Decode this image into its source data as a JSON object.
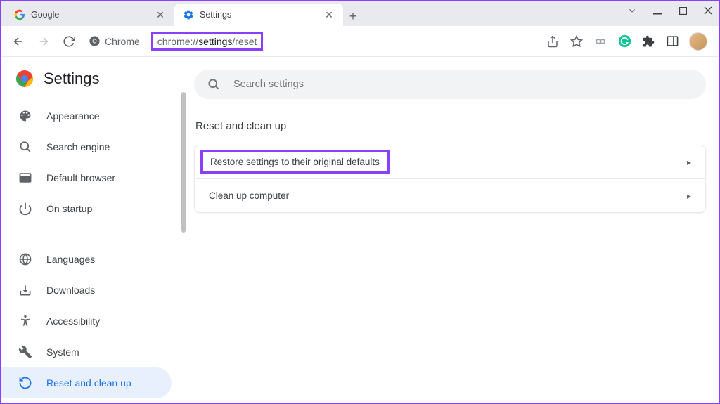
{
  "tabs": [
    {
      "title": "Google",
      "icon": "google"
    },
    {
      "title": "Settings",
      "icon": "gear-blue"
    }
  ],
  "url": {
    "prefix": "chrome://",
    "dark": "settings",
    "suffix": "/reset"
  },
  "chrome_label": "Chrome",
  "settings_title": "Settings",
  "search_placeholder": "Search settings",
  "sidebar": {
    "items": [
      {
        "icon": "palette",
        "label": "Appearance"
      },
      {
        "icon": "search",
        "label": "Search engine"
      },
      {
        "icon": "browser",
        "label": "Default browser"
      },
      {
        "icon": "power",
        "label": "On startup"
      }
    ],
    "items2": [
      {
        "icon": "globe",
        "label": "Languages"
      },
      {
        "icon": "download",
        "label": "Downloads"
      },
      {
        "icon": "accessibility",
        "label": "Accessibility"
      },
      {
        "icon": "wrench",
        "label": "System"
      },
      {
        "icon": "reset",
        "label": "Reset and clean up"
      }
    ]
  },
  "section_title": "Reset and clean up",
  "rows": [
    {
      "label": "Restore settings to their original defaults"
    },
    {
      "label": "Clean up computer"
    }
  ]
}
